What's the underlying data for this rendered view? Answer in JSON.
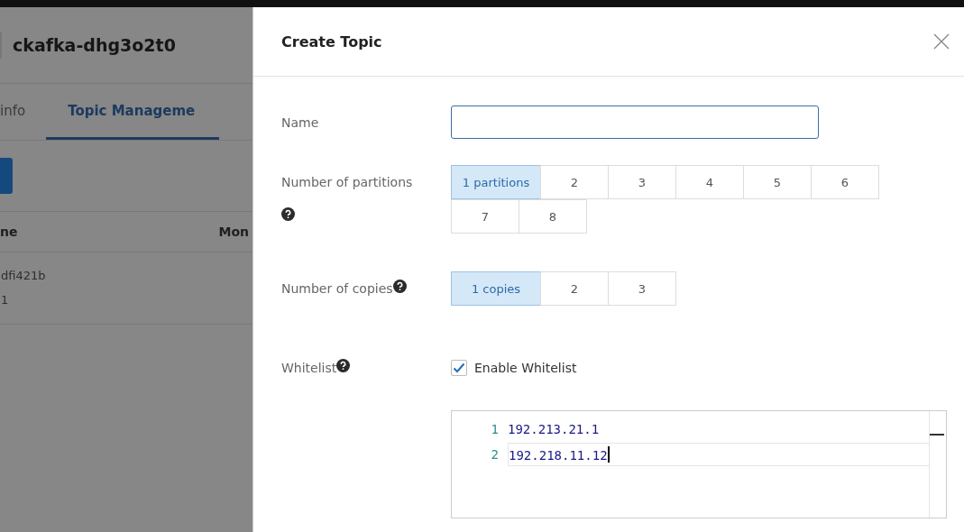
{
  "background_page": {
    "title": "ckafka-dhg3o2t0",
    "tabs": [
      {
        "label": "info",
        "selected": false
      },
      {
        "label": "Topic Manageme",
        "selected": true
      }
    ],
    "table": {
      "columns": [
        "ne",
        "Mon"
      ],
      "rows": [
        {
          "column_1": [
            "dfi421b",
            "1"
          ]
        }
      ]
    }
  },
  "drawer": {
    "title": "Create Topic",
    "fields": [
      {
        "kind": "text",
        "label": "Name"
      },
      {
        "kind": "choices",
        "label": "Number of partitions",
        "help": true,
        "options": [
          {
            "label": "1 partitions",
            "selected": true
          },
          {
            "label": "2",
            "selected": false
          },
          {
            "label": "3",
            "selected": false
          },
          {
            "label": "4",
            "selected": false
          },
          {
            "label": "5",
            "selected": false
          },
          {
            "label": "6",
            "selected": false
          },
          {
            "label": "7",
            "selected": false
          },
          {
            "label": "8",
            "selected": false
          }
        ]
      },
      {
        "kind": "choices",
        "label": "Number of copies",
        "help": true,
        "options": [
          {
            "label": "1 copies",
            "selected": true
          },
          {
            "label": "2",
            "selected": false
          },
          {
            "label": "3",
            "selected": false
          }
        ]
      },
      {
        "kind": "checkbox",
        "label": "Whitelist",
        "help": true,
        "checkbox_label": "Enable Whitelist",
        "checked": true
      },
      {
        "kind": "editor",
        "lines": [
          {
            "number": "1",
            "text": "192.213.21.1",
            "current": false
          },
          {
            "number": "2",
            "text": "192.218.11.12",
            "current": true
          }
        ]
      }
    ]
  }
}
